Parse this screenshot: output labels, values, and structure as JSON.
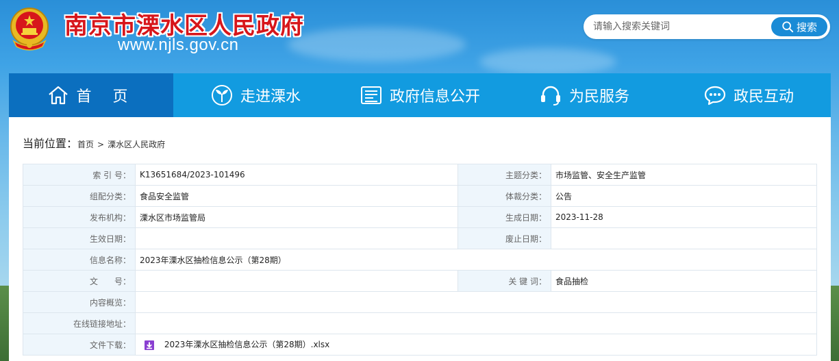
{
  "header": {
    "site_title": "南京市溧水区人民政府",
    "site_url": "www.njls.gov.cn",
    "emblem_icon": "national-emblem-icon"
  },
  "search": {
    "placeholder": "请输入搜索关键词",
    "button_label": "搜索"
  },
  "nav": {
    "items": [
      {
        "label": "首 页",
        "icon": "home-icon"
      },
      {
        "label": "走进溧水",
        "icon": "sprout-icon"
      },
      {
        "label": "政府信息公开",
        "icon": "document-icon"
      },
      {
        "label": "为民服务",
        "icon": "headset-icon"
      },
      {
        "label": "政民互动",
        "icon": "chat-icon"
      }
    ]
  },
  "breadcrumb": {
    "prefix": "当前位置：",
    "home": "首页",
    "separator": ">",
    "current": "溧水区人民政府"
  },
  "info": {
    "index_label": "索 引 号：",
    "index_value": "K13651684/2023-101496",
    "topic_label": "主题分类：",
    "topic_value": "市场监管、安全生产监管",
    "org_cat_label": "组配分类：",
    "org_cat_value": "食品安全监管",
    "genre_label": "体裁分类：",
    "genre_value": "公告",
    "publisher_label": "发布机构：",
    "publisher_value": "溧水区市场监管局",
    "created_label": "生成日期：",
    "created_value": "2023-11-28",
    "effective_label": "生效日期：",
    "effective_value": "",
    "expiry_label": "废止日期：",
    "expiry_value": "",
    "name_label": "信息名称：",
    "name_value": "2023年溧水区抽检信息公示（第28期）",
    "docno_label": "文　　号：",
    "docno_value": "",
    "keywords_label": "关 键 词：",
    "keywords_value": "食品抽检",
    "summary_label": "内容概览：",
    "summary_value": "",
    "link_label": "在线链接地址：",
    "link_value": "",
    "download_label": "文件下载：",
    "download_file": "2023年溧水区抽检信息公示（第28期）.xlsx",
    "download_icon": "download-icon"
  },
  "colors": {
    "nav_bg": "#129be0",
    "nav_active": "#0b6fbf",
    "title_red": "#d7161b",
    "search_btn": "#1a8bd6",
    "label_bg": "#eef6fc"
  }
}
